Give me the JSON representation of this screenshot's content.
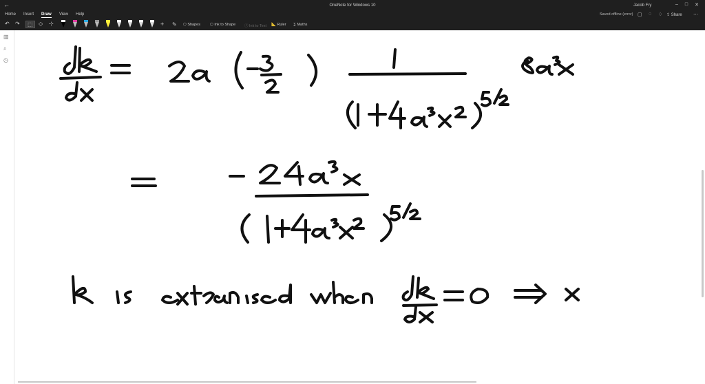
{
  "window": {
    "title": "OneNote for Windows 10",
    "user": "Jacob Fry",
    "controls": [
      "–",
      "□",
      "✕"
    ]
  },
  "ribbon": {
    "tabs": [
      {
        "label": "Home",
        "active": false
      },
      {
        "label": "Insert",
        "active": false
      },
      {
        "label": "Draw",
        "active": true
      },
      {
        "label": "View",
        "active": false
      },
      {
        "label": "Help",
        "active": false
      }
    ],
    "status": "Saved offline (error)",
    "share_label": "Share"
  },
  "toolbar": {
    "shapes_label": "Shapes",
    "ink_to_shape_label": "Ink to Shape",
    "ink_to_text_label": "Ink to Text",
    "ruler_label": "Ruler",
    "maths_label": "Maths",
    "pen_colors": [
      "#000000",
      "#e13ca1",
      "#2aa8e0",
      "#9a9a9a",
      "#ffef3a",
      "#ffffff",
      "#ffffff",
      "#ffffff",
      "#ffffff",
      "#ffffff"
    ]
  },
  "ink": {
    "stroke_color": "#111111"
  }
}
